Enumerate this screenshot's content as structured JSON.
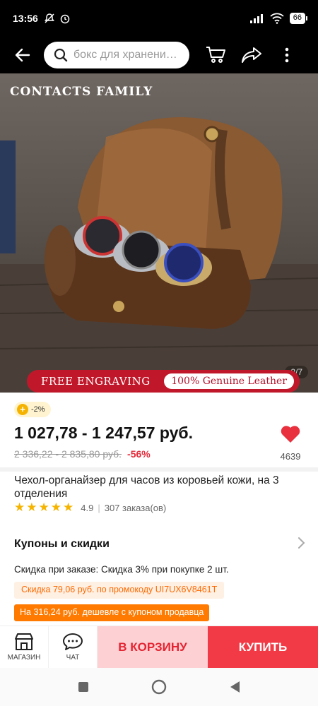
{
  "status_bar": {
    "time": "13:56",
    "battery": "66"
  },
  "header": {
    "search_placeholder": "бокс для хранения ..."
  },
  "product_image": {
    "brand": "CONTACTS FAMILY",
    "counter": "2/7",
    "promo_left": "FREE ENGRAVING",
    "promo_right": "100% Genuine Leather"
  },
  "price": {
    "discount_chip": "-2%",
    "current_range": "1 027,78 - 1 247,57 руб.",
    "old_range": "2 336,22 - 2 835,80 руб.",
    "discount_percent": "-56%",
    "favorites_count": "4639"
  },
  "product": {
    "title": "Чехол-органайзер для часов из коровьей кожи, на 3 отделения",
    "rating": "4.9",
    "separator": "|",
    "orders": "307 заказа(ов)",
    "stars": 5
  },
  "coupons": {
    "heading": "Купоны и скидки",
    "order_discount": "Скидка при заказе: Скидка 3% при покупке 2 шт.",
    "promo_code": "Скидка 79,06 руб. по промокоду UI7UX6V8461T",
    "seller_coupon": "На 316,24 руб. дешевле с купоном продавца"
  },
  "bottom_bar": {
    "shop_label": "МАГАЗИН",
    "chat_label": "ЧАТ",
    "cart_label": "В КОРЗИНУ",
    "buy_label": "КУПИТЬ"
  },
  "colors": {
    "accent_red": "#f23a46",
    "cart_bg": "#fdd0d3",
    "promo_orange": "#ff7a00",
    "star": "#f5b400"
  }
}
